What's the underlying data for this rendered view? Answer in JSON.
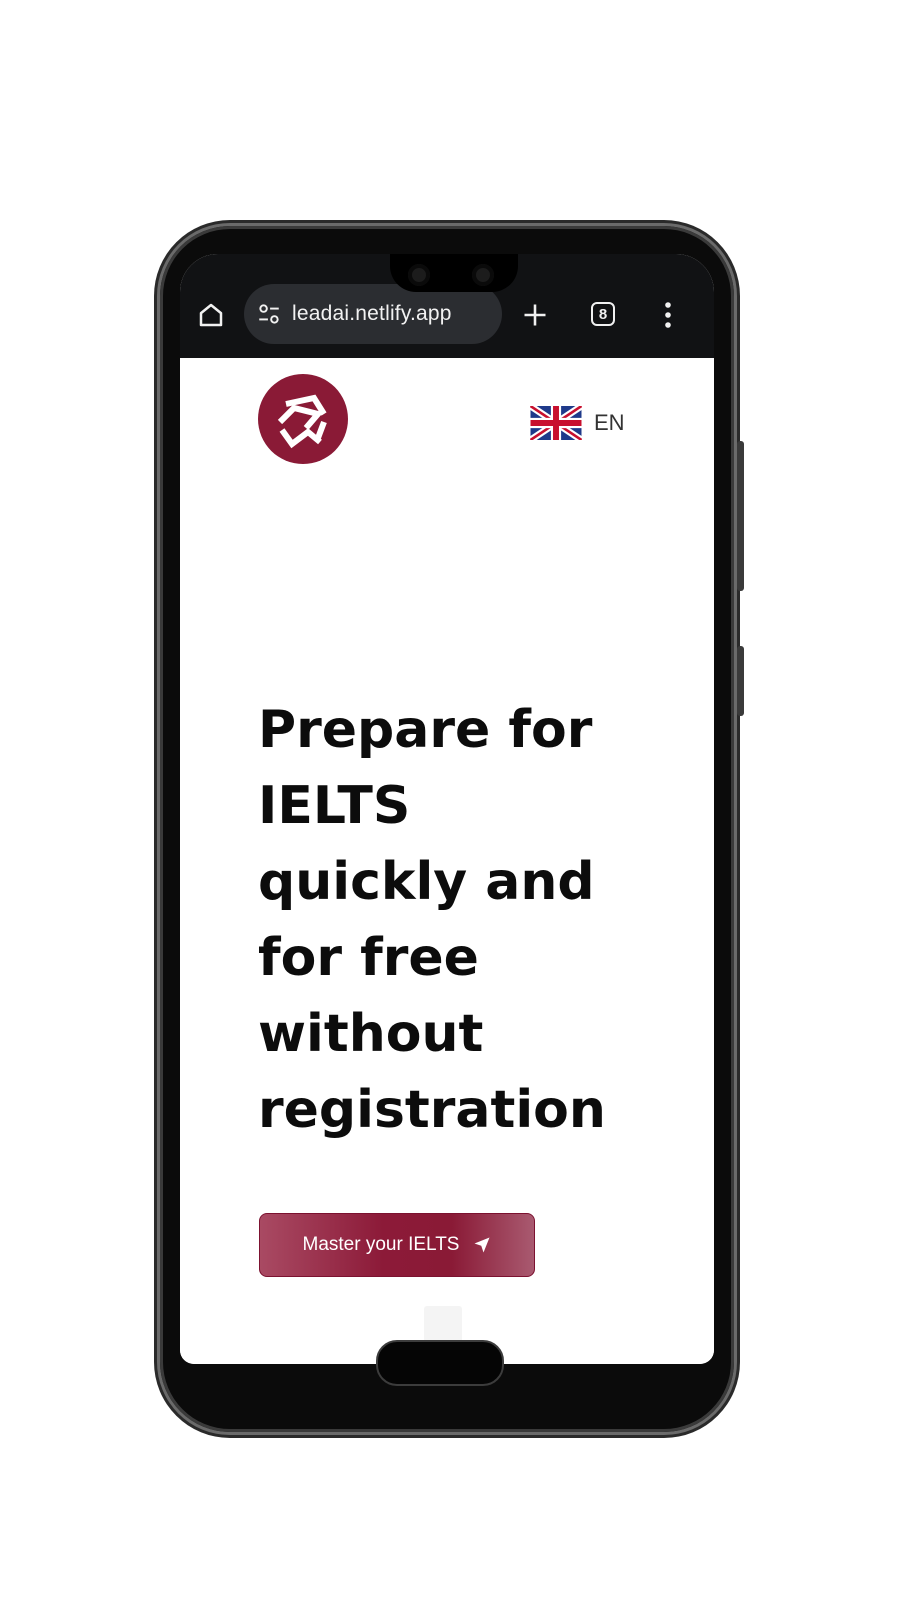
{
  "browser": {
    "url_text": "leadai.netlify.app",
    "tab_count": "8",
    "icons": {
      "home": "home-icon",
      "site_settings": "tune-icon",
      "new_tab": "plus-icon",
      "tabs": "tab-switcher-icon",
      "menu": "more-vert-icon"
    }
  },
  "header": {
    "logo": "brand-logo",
    "language": {
      "flag": "uk-flag-icon",
      "code": "EN"
    }
  },
  "hero": {
    "lines": [
      "Prepare for",
      "IELTS",
      "quickly and",
      "for free",
      "without",
      "registration"
    ]
  },
  "cta": {
    "label": "Master your IELTS",
    "icon": "send-icon"
  },
  "colors": {
    "brand": "#8a1a36",
    "toolbar": "#111214",
    "urlbar": "#2b2d31",
    "heading": "#0c0c0c"
  }
}
